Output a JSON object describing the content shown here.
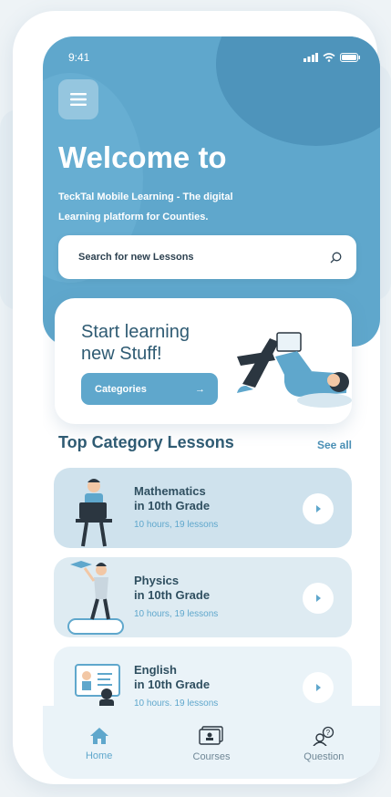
{
  "status_bar": {
    "time": "9:41"
  },
  "hero": {
    "title": "Welcome to",
    "subtitle": "TeckTal Mobile Learning - The digital Learning platform for Counties."
  },
  "search": {
    "placeholder": "Search for new Lessons"
  },
  "promo": {
    "title_line1": "Start learning",
    "title_line2": "new Stuff!",
    "button_label": "Categories"
  },
  "section": {
    "title": "Top Category Lessons",
    "see_all": "See all"
  },
  "lessons": [
    {
      "title_line1": "Mathematics",
      "title_line2": "in 10th Grade",
      "meta": "10 hours, 19 lessons"
    },
    {
      "title_line1": "Physics",
      "title_line2": "in 10th Grade",
      "meta": "10 hours, 19 lessons"
    },
    {
      "title_line1": "English",
      "title_line2": "in 10th Grade",
      "meta": "10 hours, 19 lessons"
    }
  ],
  "tabs": [
    {
      "label": "Home",
      "icon": "home-icon",
      "active": true
    },
    {
      "label": "Courses",
      "icon": "courses-icon",
      "active": false
    },
    {
      "label": "Question",
      "icon": "question-icon",
      "active": false
    }
  ],
  "colors": {
    "primary": "#5fa7cc",
    "dark_text": "#2f5b73",
    "background": "#eef3f6"
  }
}
